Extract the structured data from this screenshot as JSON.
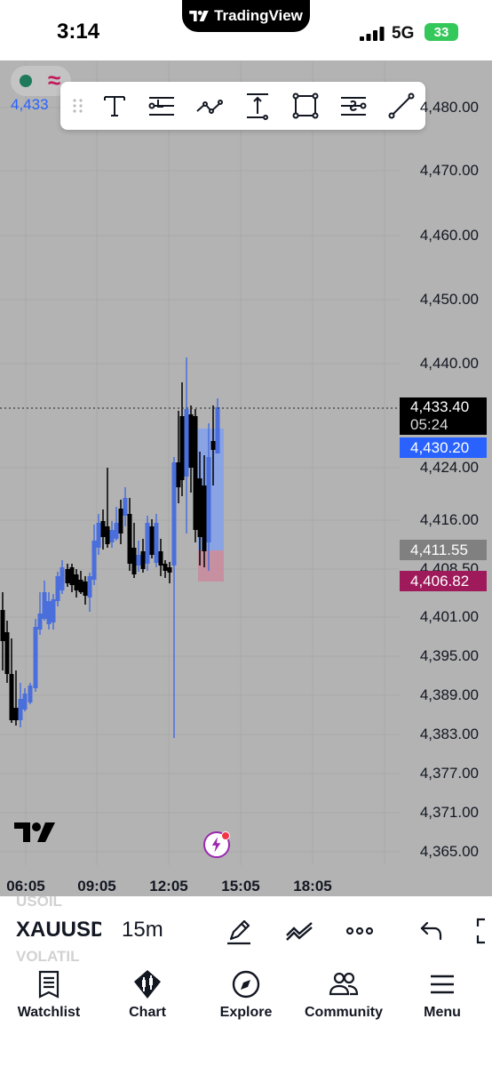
{
  "status_bar": {
    "time": "3:14",
    "app_pill": "TradingView",
    "network": "5G",
    "battery": "33"
  },
  "chart": {
    "legend_price": "4,433",
    "price_axis": [
      "4,480.00",
      "4,470.00",
      "4,460.00",
      "4,450.00",
      "4,440.00",
      "4,424.00",
      "4,416.00",
      "4,408.50",
      "4,401.00",
      "4,395.00",
      "4,389.00",
      "4,383.00",
      "4,377.00",
      "4,371.00",
      "4,365.00"
    ],
    "time_axis": [
      "06:05",
      "09:05",
      "12:05",
      "15:05",
      "18:05"
    ],
    "badges": {
      "last_price": "4,433.40",
      "countdown": "05:24",
      "target": "4,430.20",
      "entry": "4,411.55",
      "stop": "4,406.82"
    }
  },
  "toolbar_icons": [
    "drag-handle-icon",
    "text-tool-icon",
    "long-position-icon",
    "path-tool-icon",
    "price-range-icon",
    "rectangle-icon",
    "short-position-icon",
    "trend-line-icon"
  ],
  "symbol_bar": {
    "ghost_top": "USOIL",
    "symbol": "XAUUSD",
    "interval": "15m",
    "ghost_bottom": "VOLATIL"
  },
  "bottom_nav": {
    "items": [
      {
        "label": "Watchlist",
        "icon": "watchlist-icon"
      },
      {
        "label": "Chart",
        "icon": "chart-icon"
      },
      {
        "label": "Explore",
        "icon": "compass-icon"
      },
      {
        "label": "Community",
        "icon": "community-icon"
      },
      {
        "label": "Menu",
        "icon": "menu-icon"
      }
    ]
  },
  "colors": {
    "up": "#4a6fdc",
    "down": "#000000",
    "chart_bg": "#b3b3b3",
    "target_zone": "#7c9ef5",
    "stop_zone": "#c98a9c",
    "last_badge": "#000000",
    "target_badge": "#2962ff",
    "entry_badge": "#808080",
    "stop_badge": "#9e1a5a"
  }
}
